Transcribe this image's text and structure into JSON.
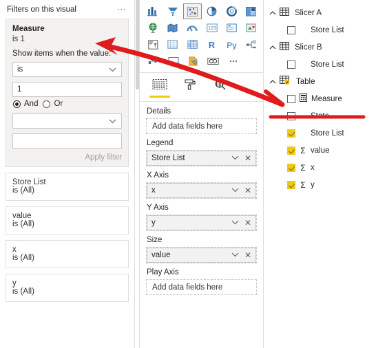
{
  "filters": {
    "title": "Filters on this visual",
    "menu_icon": "ellipsis-icon",
    "active_card": {
      "field": "Measure",
      "summary": "is 1",
      "show_items_label": "Show items when the value:",
      "operator_value": "is",
      "operator_placeholder": "",
      "value": "1",
      "value_placeholder": "",
      "conjunction_and": "And",
      "conjunction_or": "Or",
      "conjunction_selected": "And",
      "second_operator_value": "",
      "second_value": "",
      "apply_label": "Apply filter"
    },
    "cards": [
      {
        "field": "Store List",
        "summary": "is (All)"
      },
      {
        "field": "value",
        "summary": "is (All)"
      },
      {
        "field": "x",
        "summary": "is (All)"
      },
      {
        "field": "y",
        "summary": "is (All)"
      }
    ]
  },
  "visualizations": {
    "gallery": [
      [
        {
          "name": "stacked-bar-chart-icon",
          "selected": false
        },
        {
          "name": "funnel-chart-icon",
          "selected": false
        },
        {
          "name": "scatter-chart-icon",
          "selected": true
        },
        {
          "name": "pie-chart-icon",
          "selected": false
        },
        {
          "name": "donut-chart-icon",
          "selected": false
        },
        {
          "name": "treemap-icon",
          "selected": false
        }
      ],
      [
        {
          "name": "map-icon",
          "selected": false
        },
        {
          "name": "filled-map-icon",
          "selected": false
        },
        {
          "name": "gauge-icon",
          "selected": false
        },
        {
          "name": "card-icon",
          "selected": false
        },
        {
          "name": "multi-row-card-icon",
          "selected": false
        },
        {
          "name": "kpi-icon",
          "selected": false
        }
      ],
      [
        {
          "name": "slicer-icon",
          "selected": false
        },
        {
          "name": "table-icon",
          "selected": false
        },
        {
          "name": "matrix-icon",
          "selected": false
        },
        {
          "name": "r-script-visual-icon",
          "selected": false
        },
        {
          "name": "python-visual-icon",
          "selected": false
        },
        {
          "name": "decomposition-tree-icon",
          "selected": false
        }
      ],
      [
        {
          "name": "key-influencers-icon",
          "selected": false
        },
        {
          "name": "smart-narrative-icon",
          "selected": false
        },
        {
          "name": "paginated-report-icon",
          "selected": false
        },
        {
          "name": "arcgis-maps-icon",
          "selected": false
        },
        {
          "name": "more-visuals-icon",
          "selected": false
        }
      ]
    ],
    "tabs": [
      {
        "label": "Details",
        "icon": "fields-icon",
        "selected": true
      },
      {
        "label": "Format",
        "icon": "paint-roller-icon",
        "selected": false
      },
      {
        "label": "Analytics",
        "icon": "magnifier-icon",
        "selected": false
      }
    ],
    "active_tab_label": "Details",
    "wells": [
      {
        "title": "",
        "placeholder": "Add data fields here",
        "value": "",
        "empty": true
      },
      {
        "title": "Legend",
        "value": "Store List",
        "empty": false
      },
      {
        "title": "X Axis",
        "value": "x",
        "empty": false
      },
      {
        "title": "Y Axis",
        "value": "y",
        "empty": false
      },
      {
        "title": "Size",
        "value": "value",
        "empty": false
      },
      {
        "title": "Play Axis",
        "placeholder": "Add data fields here",
        "value": "",
        "empty": true
      }
    ]
  },
  "fields": {
    "tables": [
      {
        "name": "Slicer A",
        "icon": "table-grid-icon",
        "has_check_badge": false,
        "expanded": true,
        "fields": [
          {
            "name": "Store List",
            "checked": false,
            "aggregate": false,
            "icon": ""
          }
        ]
      },
      {
        "name": "Slicer B",
        "icon": "table-grid-icon",
        "has_check_badge": false,
        "expanded": true,
        "fields": [
          {
            "name": "Store List",
            "checked": false,
            "aggregate": false,
            "icon": ""
          }
        ]
      },
      {
        "name": "Table",
        "icon": "table-grid-icon",
        "has_check_badge": true,
        "expanded": true,
        "fields": [
          {
            "name": "Measure",
            "checked": false,
            "aggregate": false,
            "icon": "calculator-icon"
          },
          {
            "name": "State",
            "checked": false,
            "aggregate": false,
            "icon": ""
          },
          {
            "name": "Store List",
            "checked": true,
            "aggregate": false,
            "icon": ""
          },
          {
            "name": "value",
            "checked": true,
            "aggregate": true,
            "icon": "sigma-icon"
          },
          {
            "name": "x",
            "checked": true,
            "aggregate": true,
            "icon": "sigma-icon"
          },
          {
            "name": "y",
            "checked": true,
            "aggregate": true,
            "icon": "sigma-icon"
          }
        ]
      }
    ]
  },
  "annotations": {
    "color": "#e01b1b",
    "arrow_name": "red-arrow-pointing-to-measure-filter",
    "underline_name": "red-underline-under-measure-field"
  },
  "colors": {
    "accent_yellow": "#f2c811",
    "annotation_red": "#e01b1b",
    "border": "#e1dfdd",
    "panel_grey": "#f3f2f1",
    "text": "#252423"
  }
}
